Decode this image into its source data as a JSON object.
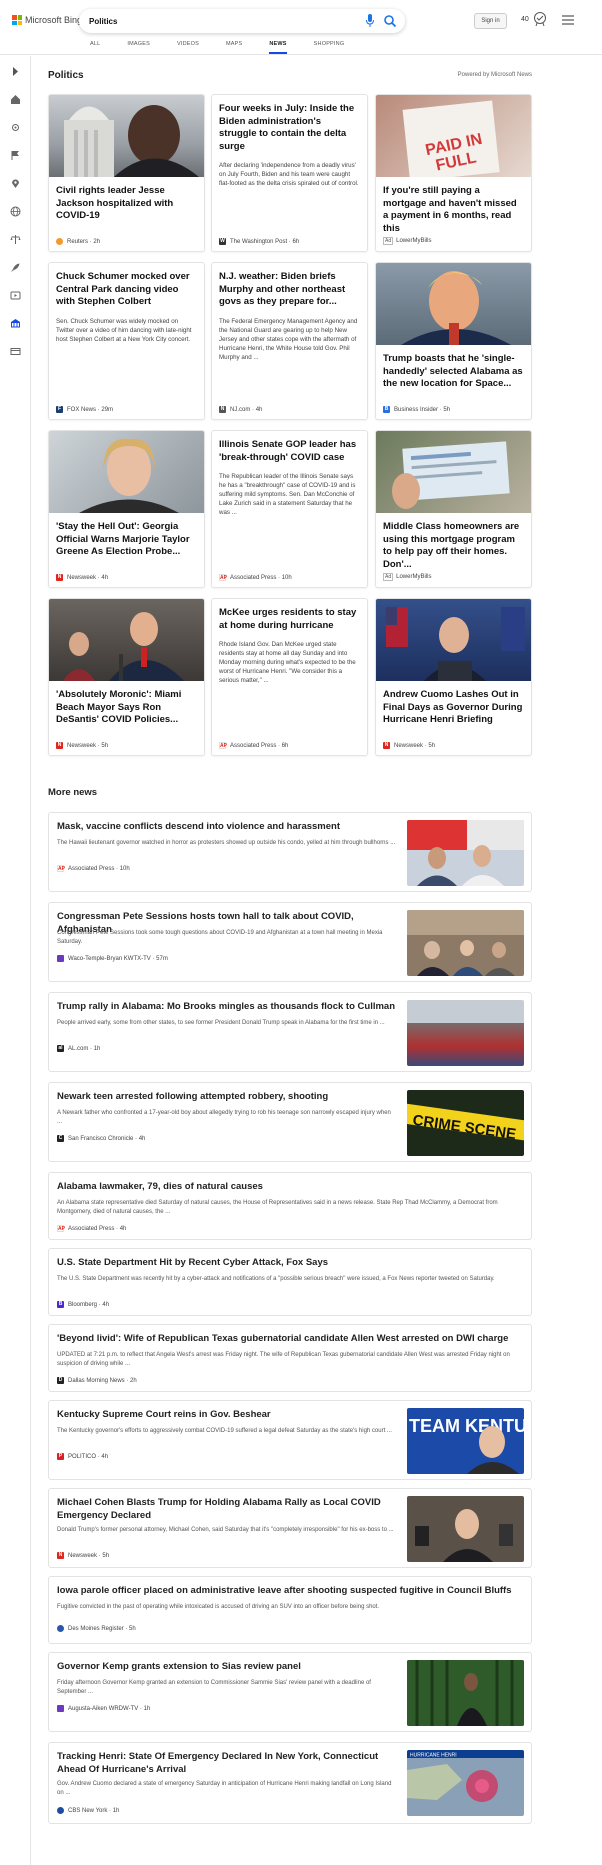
{
  "header": {
    "logo_text": "Microsoft Bing",
    "search_value": "Politics",
    "sign_in": "Sign in",
    "points": "40",
    "nav": [
      "ALL",
      "IMAGES",
      "VIDEOS",
      "MAPS",
      "NEWS",
      "SHOPPING"
    ],
    "active_nav": "NEWS"
  },
  "section": {
    "title": "Politics",
    "powered_by": "Powered by Microsoft News"
  },
  "cards": [
    {
      "title": "Civil rights leader Jesse Jackson hospitalized with COVID-19",
      "desc": "",
      "source": "Reuters",
      "time": "2h",
      "ad": false,
      "src_color": "#f29a30",
      "has_image": true
    },
    {
      "title": "Four weeks in July: Inside the Biden administration's struggle to contain the delta surge",
      "desc": "After declaring 'independence from a deadly virus' on July Fourth, Biden and his team were caught flat-footed as the delta crisis spiraled out of control.",
      "source": "The Washington Post",
      "time": "6h",
      "ad": false,
      "src_color": "#333333",
      "has_image": false
    },
    {
      "title": "If you're still paying a mortgage and haven't missed a payment in 6 months, read this",
      "desc": "",
      "source": "LowerMyBills",
      "time": "",
      "ad": true,
      "src_color": "#ffffff",
      "has_image": true
    },
    {
      "title": "Chuck Schumer mocked over Central Park dancing video with Stephen Colbert",
      "desc": "Sen. Chuck Schumer was widely mocked on Twitter over a video of him dancing with late-night host Stephen Colbert at a New York City concert.",
      "source": "FOX News",
      "time": "29m",
      "ad": false,
      "src_color": "#1b3c6e",
      "has_image": false
    },
    {
      "title": "N.J. weather: Biden briefs Murphy and other northeast govs as they prepare for...",
      "desc": "The Federal Emergency Management Agency and the National Guard are gearing up to help New Jersey and other states cope with the aftermath of Hurricane Henri, the White House told Gov. Phil Murphy and ...",
      "source": "NJ.com",
      "time": "4h",
      "ad": false,
      "src_color": "#555555",
      "has_image": false
    },
    {
      "title": "Trump boasts that he 'single-handedly' selected Alabama as the new location for Space...",
      "desc": "",
      "source": "Business Insider",
      "time": "5h",
      "ad": false,
      "src_color": "#2a6ee0",
      "has_image": true
    },
    {
      "title": "'Stay the Hell Out': Georgia Official Warns Marjorie Taylor Greene As Election Probe...",
      "desc": "",
      "source": "Newsweek",
      "time": "4h",
      "ad": false,
      "src_color": "#e0261d",
      "has_image": true
    },
    {
      "title": "Illinois Senate GOP leader has 'break-through' COVID case",
      "desc": "The Republican leader of the Illinois Senate says he has a \"breakthrough\" case of COVID-19 and is suffering mild symptoms. Sen. Dan McConchie of Lake Zurich said in a statement Saturday that he was ...",
      "source": "Associated Press",
      "time": "10h",
      "ad": false,
      "src_color": "#ffffff",
      "has_image": false
    },
    {
      "title": "Middle Class homeowners are using this mortgage program to help pay off their homes. Don'...",
      "desc": "",
      "source": "LowerMyBills",
      "time": "",
      "ad": true,
      "src_color": "#ffffff",
      "has_image": true
    },
    {
      "title": "'Absolutely Moronic': Miami Beach Mayor Says Ron DeSantis' COVID Policies...",
      "desc": "",
      "source": "Newsweek",
      "time": "5h",
      "ad": false,
      "src_color": "#e0261d",
      "has_image": true
    },
    {
      "title": "McKee urges residents to stay at home during hurricane",
      "desc": "Rhode Island Gov. Dan McKee urged state residents stay at home all day Sunday and into Monday morning during what's expected to be the worst of Hurricane Henri. \"We consider this a serious matter,\" ...",
      "source": "Associated Press",
      "time": "6h",
      "ad": false,
      "src_color": "#ffffff",
      "has_image": false
    },
    {
      "title": "Andrew Cuomo Lashes Out in Final Days as Governor During Hurricane Henri Briefing",
      "desc": "",
      "source": "Newsweek",
      "time": "5h",
      "ad": false,
      "src_color": "#e0261d",
      "has_image": true
    }
  ],
  "more_news": {
    "title": "More news",
    "items": [
      {
        "title": "Mask, vaccine conflicts descend into violence and harassment",
        "desc": "The Hawaii lieutenant governor watched in horror as protesters showed up outside his condo, yelled at him through bullhorns ...",
        "source": "Associated Press",
        "time": "10h",
        "src_color": "#ffffff",
        "thumb": true
      },
      {
        "title": "Congressman Pete Sessions hosts town hall to talk about COVID, Afghanistan",
        "desc": "Congressman Pete Sessions took some tough questions about COVID-19 and Afghanistan at a town hall meeting in Mexia Saturday.",
        "source": "Waco-Temple-Bryan KWTX-TV",
        "time": "57m",
        "src_color": "#6a3ac0",
        "thumb": true
      },
      {
        "title": "Trump rally in Alabama: Mo Brooks mingles as thousands flock to Cullman",
        "desc": "People arrived early, some from other states, to see former President Donald Trump speak in Alabama for the first time in ...",
        "source": "AL.com",
        "time": "1h",
        "src_color": "#222222",
        "thumb": true
      },
      {
        "title": "Newark teen arrested following attempted robbery, shooting",
        "desc": "A Newark father who confronted a 17-year-old boy about allegedly trying to rob his teenage son narrowly escaped injury when ...",
        "source": "San Francisco Chronicle",
        "time": "4h",
        "src_color": "#222222",
        "thumb": true
      },
      {
        "title": "Alabama lawmaker, 79, dies of natural causes",
        "desc": "An Alabama state representative died Saturday of natural causes, the House of Representatives said in a news release. State Rep Thad McClammy, a Democrat from Montgomery, died of natural causes, the ...",
        "source": "Associated Press",
        "time": "4h",
        "src_color": "#ffffff",
        "thumb": false
      },
      {
        "title": "U.S. State Department Hit by Recent Cyber Attack, Fox Says",
        "desc": "The U.S. State Department was recently hit by a cyber-attack and notifications of a \"possible serious breach\" were issued, a Fox News reporter tweeted on Saturday.",
        "source": "Bloomberg",
        "time": "4h",
        "src_color": "#4b2ad6",
        "thumb": false
      },
      {
        "title": "'Beyond livid': Wife of Republican Texas gubernatorial candidate Allen West arrested on DWI charge",
        "desc": "UPDATED at 7:21 p.m. to reflect that Angela West's arrest was Friday night. The wife of Republican Texas gubernatorial candidate Allen West was arrested Friday night on suspicion of driving while ...",
        "source": "Dallas Morning News",
        "time": "2h",
        "src_color": "#222222",
        "thumb": false
      },
      {
        "title": "Kentucky Supreme Court reins in Gov. Beshear",
        "desc": "The Kentucky governor's efforts to aggressively combat COVID-19 suffered a legal defeat Saturday as the state's high court ...",
        "source": "POLITICO",
        "time": "4h",
        "src_color": "#d4232b",
        "thumb": true
      },
      {
        "title": "Michael Cohen Blasts Trump for Holding Alabama Rally as Local COVID Emergency Declared",
        "desc": "Donald Trump's former personal attorney, Michael Cohen, said Saturday that it's \"completely irresponsible\" for his ex-boss to ...",
        "source": "Newsweek",
        "time": "5h",
        "src_color": "#e0261d",
        "thumb": true
      },
      {
        "title": "Iowa parole officer placed on administrative leave after shooting suspected fugitive in Council Bluffs",
        "desc": "Fugitive convicted in the past of operating while intoxicated is accused of driving an SUV into an officer before being shot.",
        "source": "Des Moines Register",
        "time": "5h",
        "src_color": "#2b57a6",
        "thumb": false
      },
      {
        "title": "Governor Kemp grants extension to Sias review panel",
        "desc": "Friday afternoon Governor Kemp granted an extension to Commissioner Sammie Sias' review panel with a deadline of September ...",
        "source": "Augusta-Aiken WRDW-TV",
        "time": "1h",
        "src_color": "#6a3ac0",
        "thumb": true
      },
      {
        "title": "Tracking Henri: State Of Emergency Declared In New York, Connecticut Ahead Of Hurricane's Arrival",
        "desc": "Gov. Andrew Cuomo declared a state of emergency Saturday in anticipation of Hurricane Henri making landfall on Long Island on ...",
        "source": "CBS New York",
        "time": "1h",
        "src_color": "#1d4e9c",
        "thumb": true
      }
    ]
  },
  "thumb_captions": {
    "kentucky": "TEAM KENTUCKY",
    "crime": "CRIME SCENE",
    "hurricane": "HURRICANE HENRI"
  },
  "ad_label": "Ad",
  "colors": {
    "accent": "#174ae4",
    "bing_blue": "#1a73e8"
  }
}
